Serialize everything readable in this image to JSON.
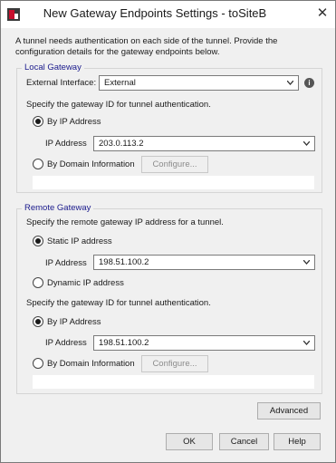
{
  "window": {
    "title": "New Gateway Endpoints Settings - toSiteB",
    "intro": "A tunnel needs authentication on each side of the tunnel. Provide the configuration details for the gateway endpoints below."
  },
  "local": {
    "legend": "Local Gateway",
    "ext_label": "External Interface:",
    "ext_value": "External",
    "gw_id_text": "Specify the gateway ID for tunnel authentication.",
    "by_ip_label": "By IP Address",
    "ip_label": "IP Address",
    "ip_value": "203.0.113.2",
    "by_domain_label": "By Domain Information",
    "configure_label": "Configure..."
  },
  "remote": {
    "legend": "Remote Gateway",
    "remote_text": "Specify the remote gateway IP address for a tunnel.",
    "static_label": "Static IP address",
    "ip_label": "IP Address",
    "static_ip_value": "198.51.100.2",
    "dynamic_label": "Dynamic IP address",
    "gw_id_text": "Specify the gateway ID for tunnel authentication.",
    "by_ip_label": "By IP Address",
    "ip_label2": "IP Address",
    "id_ip_value": "198.51.100.2",
    "by_domain_label": "By Domain Information",
    "configure_label": "Configure..."
  },
  "buttons": {
    "advanced": "Advanced",
    "ok": "OK",
    "cancel": "Cancel",
    "help": "Help"
  }
}
